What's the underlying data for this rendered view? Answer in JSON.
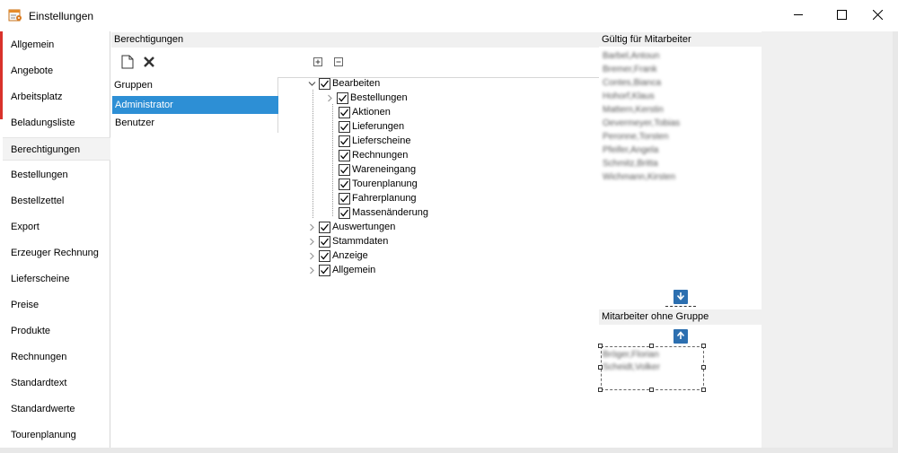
{
  "window": {
    "title": "Einstellungen",
    "icon": "settings-app-icon",
    "controls": [
      "minimize-icon",
      "maximize-icon",
      "close-icon"
    ]
  },
  "nav": {
    "items": [
      {
        "label": "Allgemein",
        "selected": false
      },
      {
        "label": "Angebote",
        "selected": false
      },
      {
        "label": "Arbeitsplatz",
        "selected": false
      },
      {
        "label": "Beladungsliste",
        "selected": false
      },
      {
        "label": "Berechtigungen",
        "selected": true
      },
      {
        "label": "Bestellungen",
        "selected": false
      },
      {
        "label": "Bestellzettel",
        "selected": false
      },
      {
        "label": "Export",
        "selected": false
      },
      {
        "label": "Erzeuger Rechnung",
        "selected": false
      },
      {
        "label": "Lieferscheine",
        "selected": false
      },
      {
        "label": "Preise",
        "selected": false
      },
      {
        "label": "Produkte",
        "selected": false
      },
      {
        "label": "Rechnungen",
        "selected": false
      },
      {
        "label": "Standardtext",
        "selected": false
      },
      {
        "label": "Standardwerte",
        "selected": false
      },
      {
        "label": "Tourenplanung",
        "selected": false
      }
    ]
  },
  "permissions": {
    "header": "Berechtigungen",
    "toolbar": {
      "new_icon": "new-document-icon",
      "delete_icon": "delete-icon",
      "expand_icon": "expand-all-icon",
      "collapse_icon": "collapse-all-icon"
    },
    "groups_label": "Gruppen",
    "groups": [
      {
        "label": "Administrator",
        "selected": true
      },
      {
        "label": "Benutzer",
        "selected": false
      }
    ],
    "tree": [
      {
        "label": "Bearbeiten",
        "checked": true,
        "expanded": true,
        "children": [
          {
            "label": "Bestellungen",
            "checked": true,
            "has_children": true
          },
          {
            "label": "Aktionen",
            "checked": true
          },
          {
            "label": "Lieferungen",
            "checked": true
          },
          {
            "label": "Lieferscheine",
            "checked": true
          },
          {
            "label": "Rechnungen",
            "checked": true
          },
          {
            "label": "Wareneingang",
            "checked": true
          },
          {
            "label": "Tourenplanung",
            "checked": true
          },
          {
            "label": "Fahrerplanung",
            "checked": true
          },
          {
            "label": "Massenänderung",
            "checked": true
          }
        ]
      },
      {
        "label": "Auswertungen",
        "checked": true,
        "expanded": false
      },
      {
        "label": "Stammdaten",
        "checked": true,
        "expanded": false
      },
      {
        "label": "Anzeige",
        "checked": true,
        "expanded": false
      },
      {
        "label": "Allgemein",
        "checked": true,
        "expanded": false
      }
    ]
  },
  "employees": {
    "valid_header": "Gültig für Mitarbeiter",
    "valid_list": [
      "Barbel,Antoun",
      "Bremer,Frank",
      "Contes,Bianca",
      "Hohorf,Klaus",
      "Mattern,Kerstin",
      "Oevermeyer,Tobias",
      "Peronne,Torsten",
      "Pfeifer,Angela",
      "Schmitz,Britta",
      "Wichmann,Kirsten"
    ],
    "no_group_header": "Mitarbeiter ohne Gruppe",
    "no_group_list": [
      "Bröger,Florian",
      "Scheidt,Volker"
    ],
    "move_down_icon": "arrow-down-icon",
    "move_up_icon": "arrow-up-icon"
  }
}
